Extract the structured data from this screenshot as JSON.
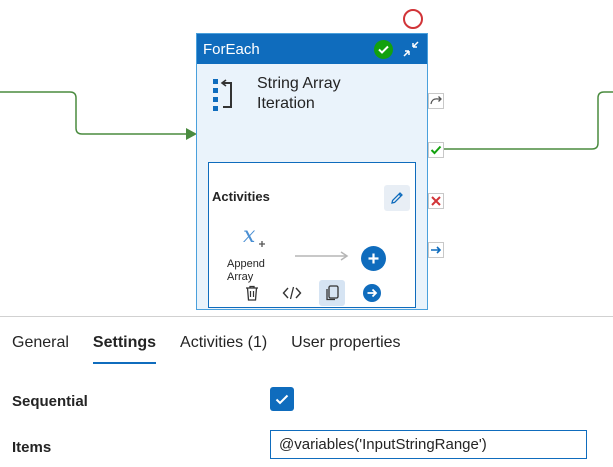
{
  "node": {
    "title": "ForEach",
    "label_line1": "String Array",
    "label_line2": "Iteration",
    "activities_title": "Activities",
    "inner_activity_line1": "Append",
    "inner_activity_line2": "Array",
    "icons": {
      "status": "success-check-icon",
      "collapse": "collapse-arrows-icon",
      "iterate": "foreach-iterate-icon",
      "edit": "pencil-icon",
      "append": "append-variable-icon",
      "add": "plus-icon",
      "delete": "trash-icon",
      "code": "code-icon",
      "copy": "copy-icon",
      "navigate": "arrow-right-circle-icon"
    },
    "colors": {
      "header": "#0f6cbd",
      "success": "#13a10e",
      "failure": "#d13438",
      "connector": "#4a8b3f"
    }
  },
  "tabs": [
    {
      "label": "General"
    },
    {
      "label": "Settings"
    },
    {
      "label": "Activities (1)"
    },
    {
      "label": "User properties"
    }
  ],
  "settings": {
    "sequential_label": "Sequential",
    "sequential_checked": true,
    "items_label": "Items",
    "items_value": "@variables('InputStringRange')"
  }
}
